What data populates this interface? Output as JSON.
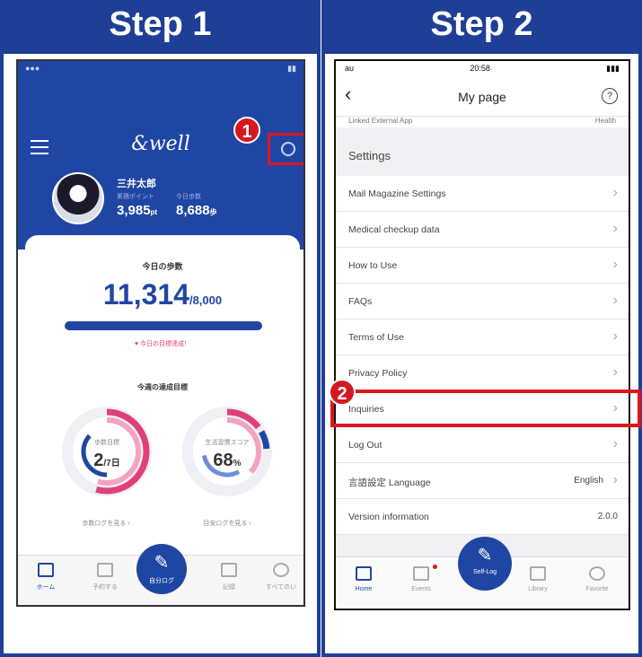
{
  "step1": {
    "title": "Step 1",
    "badge": "1",
    "app": {
      "brand": "&well",
      "user_name": "三井太郎",
      "stat1_label": "累積ポイント",
      "stat1_value": "3,985",
      "stat1_unit": "pt",
      "stat2_label": "今日歩数",
      "stat2_value": "8,688",
      "stat2_unit": "歩",
      "steps_label": "今日の歩数",
      "steps_value": "11,314",
      "steps_goal": "/8,000",
      "steps_progress": 1.0,
      "goal_note": "♥ 今日の目標達成！",
      "week_label": "今週の達成目標",
      "ring1_label": "歩数目標",
      "ring1_value": "2",
      "ring1_unit": "/7日",
      "ring1_link": "歩数ログを見る ›",
      "ring2_label": "生活習慣スコア",
      "ring2_value": "68",
      "ring2_unit": "%",
      "ring2_link": "目安ログを見る ›",
      "tabs": [
        "ホーム",
        "予約する",
        "記録",
        "すべてのい"
      ],
      "fab_label": "自分ログ"
    }
  },
  "step2": {
    "title": "Step 2",
    "badge": "2",
    "status": {
      "carrier": "au",
      "time": "20:58"
    },
    "nav_title": "My page",
    "cut_row_left": "Linked External App",
    "cut_row_right": "Health",
    "section_title": "Settings",
    "rows": [
      {
        "label": "Mail Magazine Settings"
      },
      {
        "label": "Medical checkup data"
      },
      {
        "label": "How to Use"
      },
      {
        "label": "FAQs"
      },
      {
        "label": "Terms of Use"
      },
      {
        "label": "Privacy Policy"
      },
      {
        "label": "Inquiries"
      },
      {
        "label": "Log Out"
      },
      {
        "label": "言語設定 Language",
        "value": "English"
      },
      {
        "label": "Version information",
        "value": "2.0.0"
      }
    ],
    "tabs": [
      "Home",
      "Events",
      "Library",
      "Favorite"
    ],
    "fab_label": "Self-Log"
  },
  "colors": {
    "brand_blue": "#2046a4",
    "frame_blue": "#1f3f96",
    "highlight_red": "#e0151c",
    "accent_pink": "#e0407a"
  }
}
